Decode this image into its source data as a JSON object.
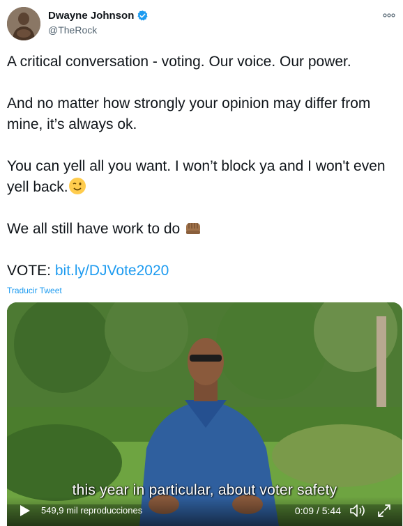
{
  "author": {
    "display_name": "Dwayne Johnson",
    "handle": "@TheRock"
  },
  "tweet": {
    "line1": "A critical conversation - voting. Our voice. Our power.",
    "line2": "And no matter how strongly your opinion may differ from mine, it’s always ok.",
    "line3": "You can yell all you want. I won’t block ya and I won't even yell back.",
    "line4": "We all still have work to do",
    "vote_label": "VOTE:",
    "vote_link": "bit.ly/DJVote2020"
  },
  "translate_label": "Traducir Tweet",
  "video": {
    "caption": "this year in particular, about voter safety",
    "views": "549,9 mil reproducciones",
    "time": "0:09 / 5:44"
  },
  "colors": {
    "link": "#1d9bf0",
    "verified": "#1d9bf0"
  }
}
